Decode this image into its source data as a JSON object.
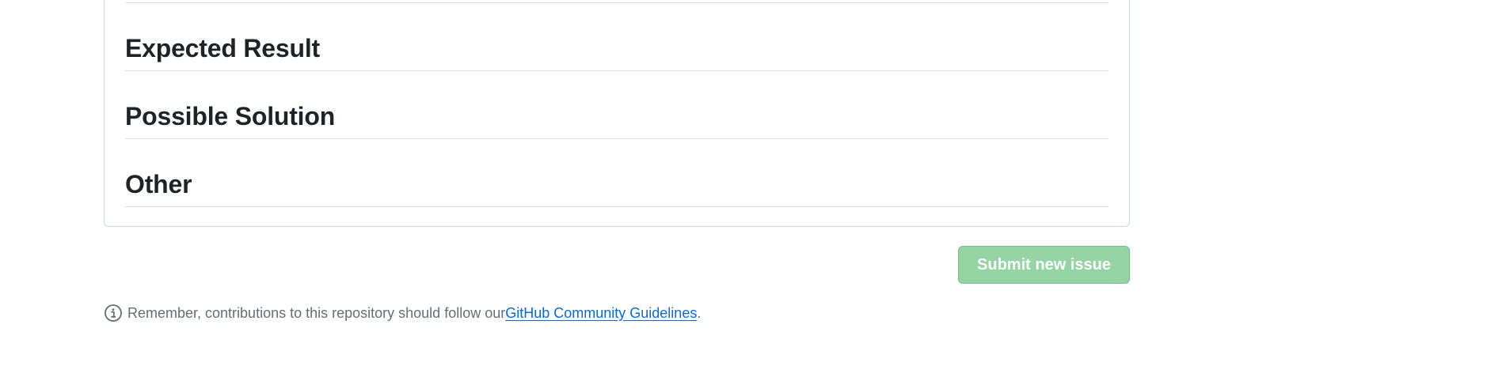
{
  "form": {
    "sections": [
      {
        "heading": "Expected Result"
      },
      {
        "heading": "Possible Solution"
      },
      {
        "heading": "Other"
      }
    ],
    "submit_label": "Submit new issue"
  },
  "notice": {
    "icon": "info-icon",
    "text_before": "Remember, contributions to this repository should follow our ",
    "link_text": "GitHub Community Guidelines",
    "text_after": "."
  },
  "colors": {
    "submit_disabled_bg": "#94d3a2",
    "link": "#0969da",
    "muted_text": "#656d76"
  }
}
